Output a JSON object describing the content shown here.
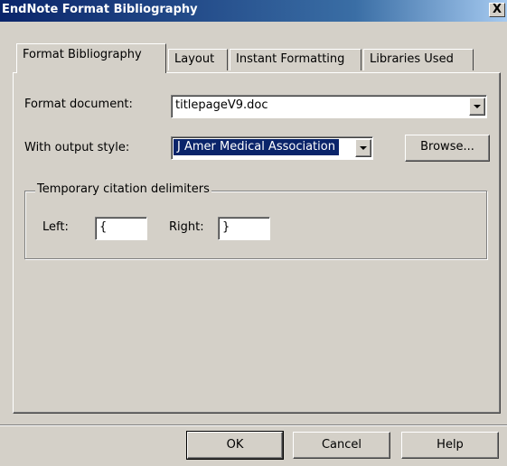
{
  "window": {
    "title": "EndNote Format Bibliography",
    "close_glyph": "X"
  },
  "tabs": [
    {
      "label": "Format Bibliography",
      "active": true
    },
    {
      "label": "Layout",
      "active": false
    },
    {
      "label": "Instant Formatting",
      "active": false
    },
    {
      "label": "Libraries Used",
      "active": false
    }
  ],
  "form": {
    "format_document_label": "Format document:",
    "format_document_value": "titlepageV9.doc",
    "output_style_label": "With output style:",
    "output_style_value": "J Amer Medical Association",
    "browse_label": "Browse...",
    "delimiters": {
      "group_title": "Temporary citation delimiters",
      "left_label": "Left:",
      "left_value": "{",
      "right_label": "Right:",
      "right_value": "}"
    }
  },
  "buttons": {
    "ok": "OK",
    "cancel": "Cancel",
    "help": "Help"
  },
  "icons": {
    "dropdown": "chevron-down-icon",
    "close": "close-icon"
  },
  "colors": {
    "titlebar_start": "#0a246a",
    "titlebar_end": "#a6caf0",
    "dialog_bg": "#d4d0c8",
    "selection": "#0a246a"
  }
}
